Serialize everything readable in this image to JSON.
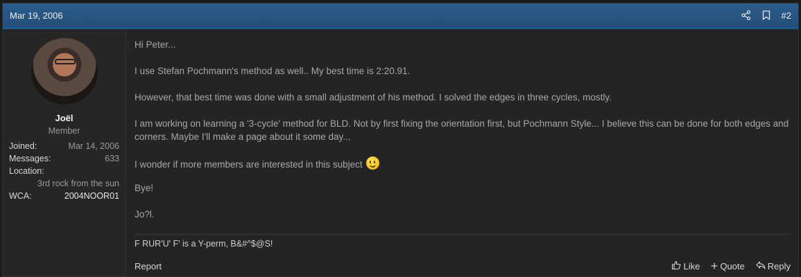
{
  "post": {
    "date": "Mar 19, 2006",
    "number": "#2"
  },
  "user": {
    "name": "Joël",
    "title": "Member",
    "stats": {
      "joined_label": "Joined:",
      "joined_value": "Mar 14, 2006",
      "messages_label": "Messages:",
      "messages_value": "633",
      "location_label": "Location:",
      "location_value": "3rd rock from the sun",
      "wca_label": "WCA:",
      "wca_value": "2004NOOR01"
    }
  },
  "message": {
    "p1": "Hi Peter...",
    "p2": "I use Stefan Pochmann's method as well.. My best time is 2:20.91.",
    "p3": "However, that best time was done with a small adjustment of his method. I solved the edges in three cycles, mostly.",
    "p4": "I am working on learning a '3-cycle' method for BLD. Not by first fixing the orientation first, but Pochmann Style... I believe this can be done for both edges and corners. Maybe I'll make a page about it some day...",
    "p5": "I wonder if more members are interested in this subject",
    "p6": "Bye!",
    "p7": "Jo?l."
  },
  "signature": "F RUR'U' F' is a Y-perm, B&#^$@S!",
  "footer": {
    "report": "Report",
    "like": "Like",
    "quote": "Quote",
    "reply": "Reply"
  },
  "icons": {
    "share": "share-icon",
    "bookmark": "bookmark-icon",
    "smiley": "smiley-icon",
    "like": "thumbs-up-icon",
    "quote": "plus-icon",
    "reply": "reply-icon"
  },
  "colors": {
    "header_bg": "#2c5d8d",
    "page_bg": "#242424"
  }
}
